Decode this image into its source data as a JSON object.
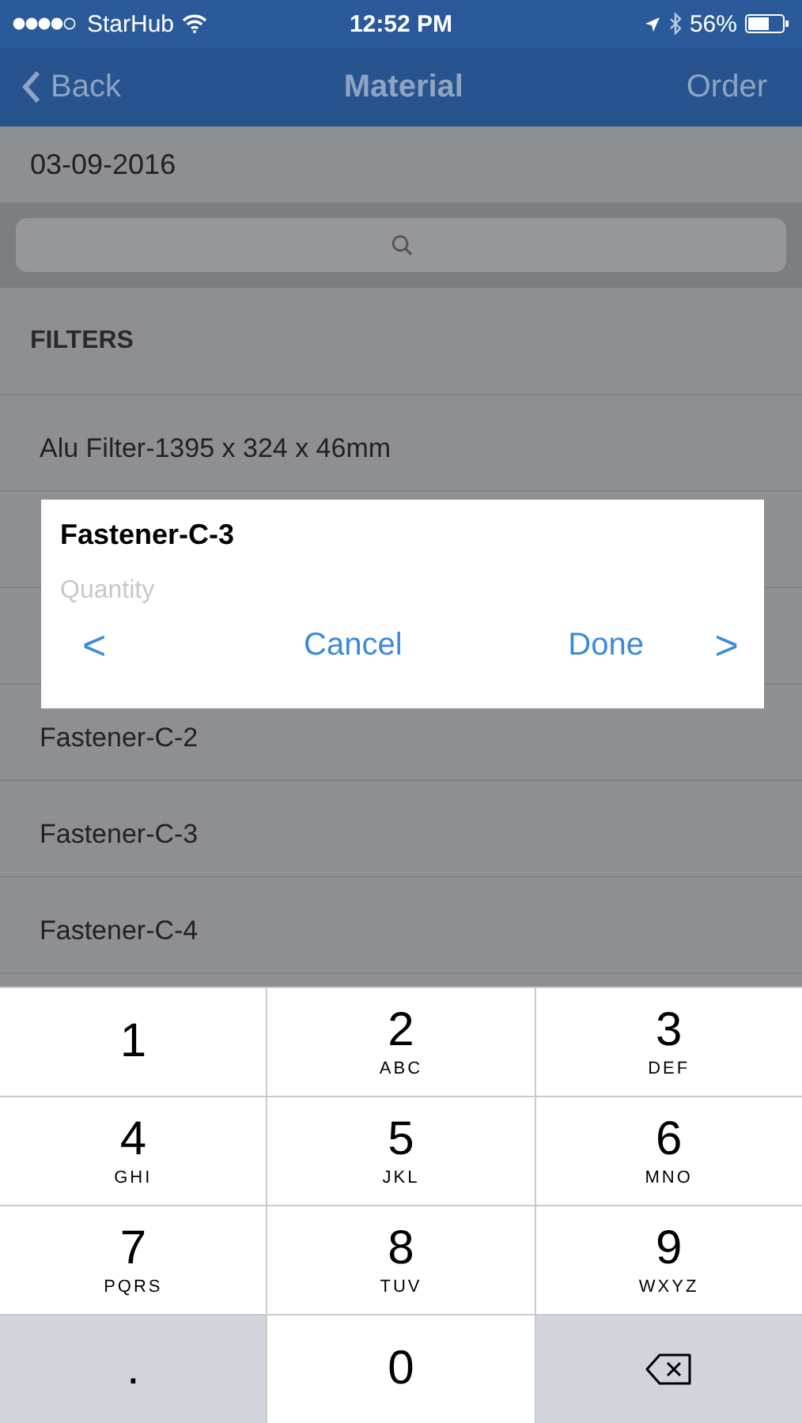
{
  "status_bar": {
    "carrier": "StarHub",
    "time": "12:52 PM",
    "battery": "56%"
  },
  "nav": {
    "back": "Back",
    "title": "Material",
    "action": "Order"
  },
  "date": "03-09-2016",
  "section": "FILTERS",
  "rows": [
    {
      "kind": "item",
      "label": "Alu Filter-1395 x 324 x 46mm"
    },
    {
      "kind": "covered"
    },
    {
      "kind": "covered"
    },
    {
      "kind": "item",
      "label": "Fastener-C-2"
    },
    {
      "kind": "item",
      "label": "Fastener-C-3"
    },
    {
      "kind": "item",
      "label": "Fastener-C-4"
    }
  ],
  "dialog": {
    "title": "Fastener-C-3",
    "placeholder": "Quantity",
    "prev": "<",
    "cancel": "Cancel",
    "done": "Done",
    "next": ">"
  },
  "keys": [
    {
      "kind": "digit",
      "digit": "1"
    },
    {
      "kind": "digit",
      "digit": "2",
      "letters": "ABC"
    },
    {
      "kind": "digit",
      "digit": "3",
      "letters": "DEF"
    },
    {
      "kind": "digit",
      "digit": "4",
      "letters": "GHI"
    },
    {
      "kind": "digit",
      "digit": "5",
      "letters": "JKL"
    },
    {
      "kind": "digit",
      "digit": "6",
      "letters": "MNO"
    },
    {
      "kind": "digit",
      "digit": "7",
      "letters": "PQRS"
    },
    {
      "kind": "digit",
      "digit": "8",
      "letters": "TUV"
    },
    {
      "kind": "digit",
      "digit": "9",
      "letters": "WXYZ"
    },
    {
      "kind": "symbol",
      "digit": "."
    },
    {
      "kind": "digit",
      "digit": "0"
    },
    {
      "kind": "delete"
    }
  ]
}
